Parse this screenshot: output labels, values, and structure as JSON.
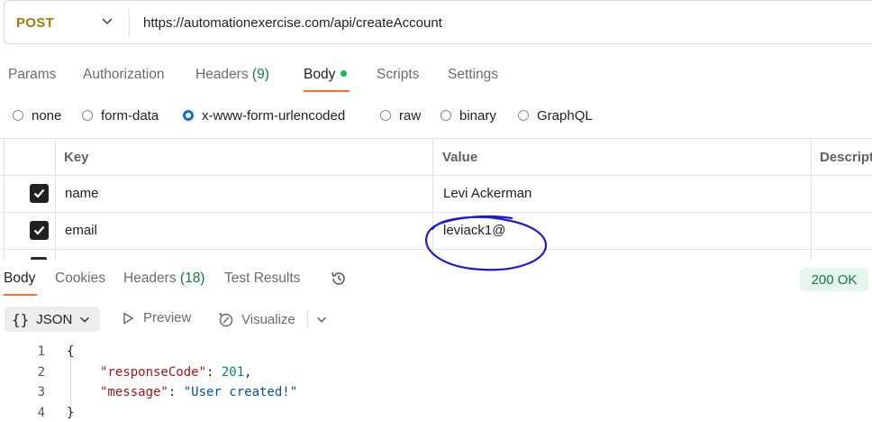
{
  "request": {
    "method": "POST",
    "url": "https://automationexercise.com/api/createAccount",
    "tabs": {
      "params": "Params",
      "authorization": "Authorization",
      "headers": "Headers",
      "headers_count": "(9)",
      "body": "Body",
      "scripts": "Scripts",
      "settings": "Settings"
    },
    "body_types": {
      "none": "none",
      "form_data": "form-data",
      "urlencoded": "x-www-form-urlencoded",
      "raw": "raw",
      "binary": "binary",
      "graphql": "GraphQL",
      "selected": "x-www-form-urlencoded"
    },
    "table": {
      "headers": {
        "key": "Key",
        "value": "Value",
        "description": "Descript"
      },
      "rows": [
        {
          "checked": true,
          "key": "name",
          "value": "Levi Ackerman"
        },
        {
          "checked": true,
          "key": "email",
          "value": "leviack1@"
        }
      ]
    }
  },
  "response": {
    "tabs": {
      "body": "Body",
      "cookies": "Cookies",
      "headers": "Headers",
      "headers_count": "(18)",
      "test_results": "Test Results"
    },
    "status": "200 OK",
    "format": "JSON",
    "preview": "Preview",
    "visualize": "Visualize",
    "lines": {
      "n1": "1",
      "n2": "2",
      "n3": "3",
      "n4": "4",
      "open": "{",
      "key1": "\"responseCode\"",
      "val1": "201",
      "key2": "\"message\"",
      "val2": "\"User created!\"",
      "close": "}"
    }
  },
  "colors": {
    "method": "#a5790a",
    "accent": "#ff6c37",
    "status_green": "#0f7a3a",
    "radio_selected": "#0b6ed9",
    "annotation": "#1c1ccc"
  },
  "icons": [
    "chevron-down-icon",
    "check-icon",
    "history-icon",
    "code-braces-icon",
    "play-icon",
    "visualize-icon"
  ]
}
